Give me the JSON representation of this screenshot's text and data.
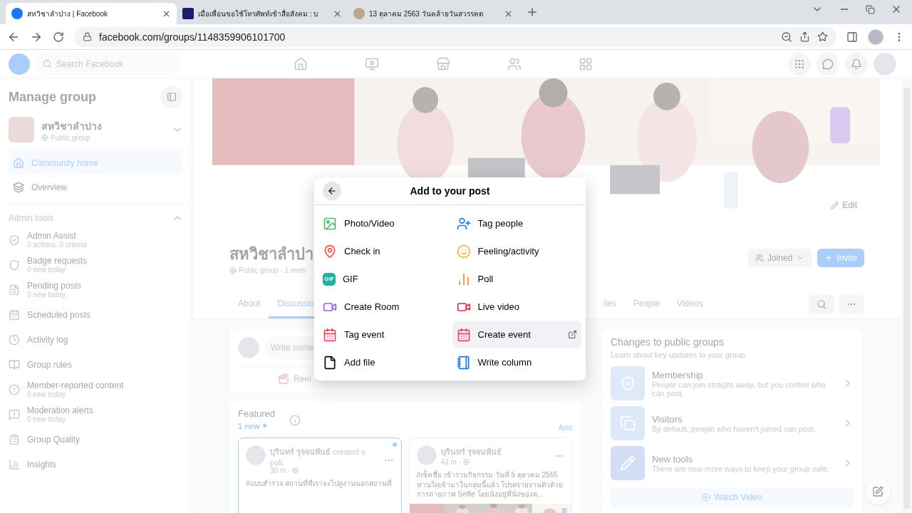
{
  "browser": {
    "tabs": [
      {
        "title": "สหวิชาลำปาง | Facebook",
        "selected": true
      },
      {
        "title": "เมื่อเพื่อนขอใช้โทรศัพท์เข้าสื่อสังคม : บ",
        "selected": false
      },
      {
        "title": "13 ตุลาคม 2563 วันคล้ายวันสวรรคต",
        "selected": false
      }
    ],
    "url": "facebook.com/groups/1148359906101700"
  },
  "nav": {
    "search": {
      "placeholder": "Search Facebook"
    }
  },
  "sidebar": {
    "title": "Manage group",
    "group": {
      "name": "สหวิชาลำปาง",
      "privacy": "Public group"
    },
    "items": [
      {
        "label": "Community home",
        "selected": true
      },
      {
        "label": "Overview",
        "selected": false
      }
    ],
    "section": {
      "title": "Admin tools",
      "expanded": true
    },
    "admin_items": [
      {
        "label": "Admin Assist",
        "sub": "0 actions, 0 criteria"
      },
      {
        "label": "Badge requests",
        "sub": "0 new today"
      },
      {
        "label": "Pending posts",
        "sub": "0 new today"
      },
      {
        "label": "Scheduled posts"
      },
      {
        "label": "Activity log"
      },
      {
        "label": "Group rules"
      },
      {
        "label": "Member-reported content",
        "sub": "0 new today"
      },
      {
        "label": "Moderation alerts",
        "sub": "0 new today"
      },
      {
        "label": "Group Quality"
      },
      {
        "label": "Insights"
      }
    ]
  },
  "group": {
    "cover": {
      "kind": "picture",
      "edit": "Edit"
    },
    "name": "สหวิชาลำปา",
    "meta": "Public group · 1 mem",
    "joined": "Joined",
    "invite": "Invite",
    "tabs": [
      {
        "label": "About",
        "selected": false
      },
      {
        "label": "Discussio",
        "selected": true
      }
    ],
    "tabs_right": [
      {
        "label": "iles",
        "selected": false
      },
      {
        "label": "People",
        "selected": false
      },
      {
        "label": "Videos",
        "selected": false
      }
    ]
  },
  "composer": {
    "placeholder": "Write some",
    "reel": "Reel"
  },
  "featured": {
    "title": "Featured",
    "new": "1 new",
    "add": "Add",
    "posts": [
      {
        "author": "บุรินทร์ รุจจนพันธ์",
        "action": "created a poll.",
        "time": "30 m ·",
        "text": "#แบบสำรวจ สถานที่ที่เราจะไปดูงานนอกสถานที่",
        "unread": true
      },
      {
        "author": "บุรินทร์ รุจจนพันธ์",
        "time": "43 m ·",
        "text": "#เช็คชื่อ เข้าร่วมกิจกรรม วันที่ 5 ตุลาคม 2565 ท่านใดเข้ามาในกลุ่มนี้แล้ว โปรดรายงานตัวด้วยการถ่ายภาพ Selfie โดยนั่งอยู่ที่นั่งของต...",
        "unread": false
      }
    ]
  },
  "changes": {
    "title": "Changes to public groups",
    "subtitle": "Learn about key updates to your group",
    "items": [
      {
        "title": "Membership",
        "text": "People can join straight away, but you control who can post."
      },
      {
        "title": "Visitors",
        "text": "By default, people who haven't joined can post."
      },
      {
        "title": "New tools",
        "text": "There are now more ways to keep your group safe."
      }
    ],
    "watch": "Watch Video"
  },
  "dialog": {
    "title": "Add to your post",
    "options": [
      {
        "label": "Photo/Video",
        "selected": false
      },
      {
        "label": "Tag people",
        "selected": false
      },
      {
        "label": "Check in",
        "selected": false
      },
      {
        "label": "Feeling/activity",
        "selected": false
      },
      {
        "label": "GIF",
        "badge": "GIF",
        "selected": false
      },
      {
        "label": "Poll",
        "selected": false
      },
      {
        "label": "Create Room",
        "selected": false
      },
      {
        "label": "Live video",
        "selected": false
      },
      {
        "label": "Tag event",
        "selected": false
      },
      {
        "label": "Create event",
        "selected": true
      },
      {
        "label": "Add file",
        "selected": false
      },
      {
        "label": "Write column",
        "selected": false
      }
    ]
  }
}
